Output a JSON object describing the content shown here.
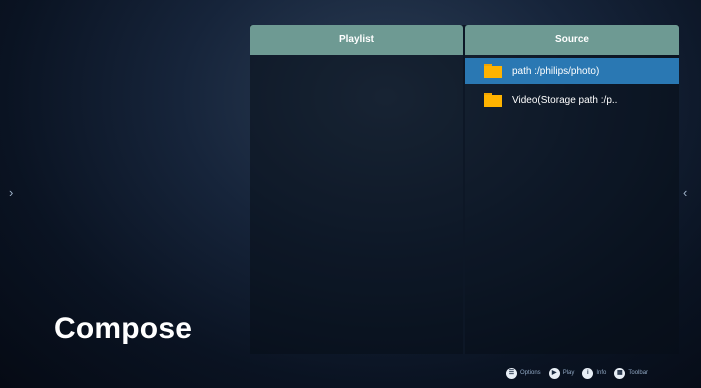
{
  "nav": {
    "left_arrow": "›",
    "right_arrow": "‹"
  },
  "page": {
    "title": "Compose"
  },
  "playlist": {
    "header": "Playlist",
    "items": []
  },
  "source": {
    "header": "Source",
    "items": [
      {
        "label": "path :/philips/photo)",
        "icon": "folder-icon",
        "selected": true
      },
      {
        "label": "Video(Storage path :/p..",
        "icon": "folder-icon",
        "selected": false
      }
    ]
  },
  "footer": {
    "hints": [
      {
        "icon": "options-key-icon",
        "glyph": "☰",
        "label": "Options"
      },
      {
        "icon": "play-key-icon",
        "glyph": "▶",
        "label": "Play"
      },
      {
        "icon": "info-key-icon",
        "glyph": "i",
        "label": "Info"
      },
      {
        "icon": "toolbar-key-icon",
        "glyph": "▦",
        "label": "Toolbar"
      }
    ]
  },
  "colors": {
    "header_bg": "#6e9a93",
    "selected_bg": "#2a78b3",
    "folder": "#ffb300"
  }
}
